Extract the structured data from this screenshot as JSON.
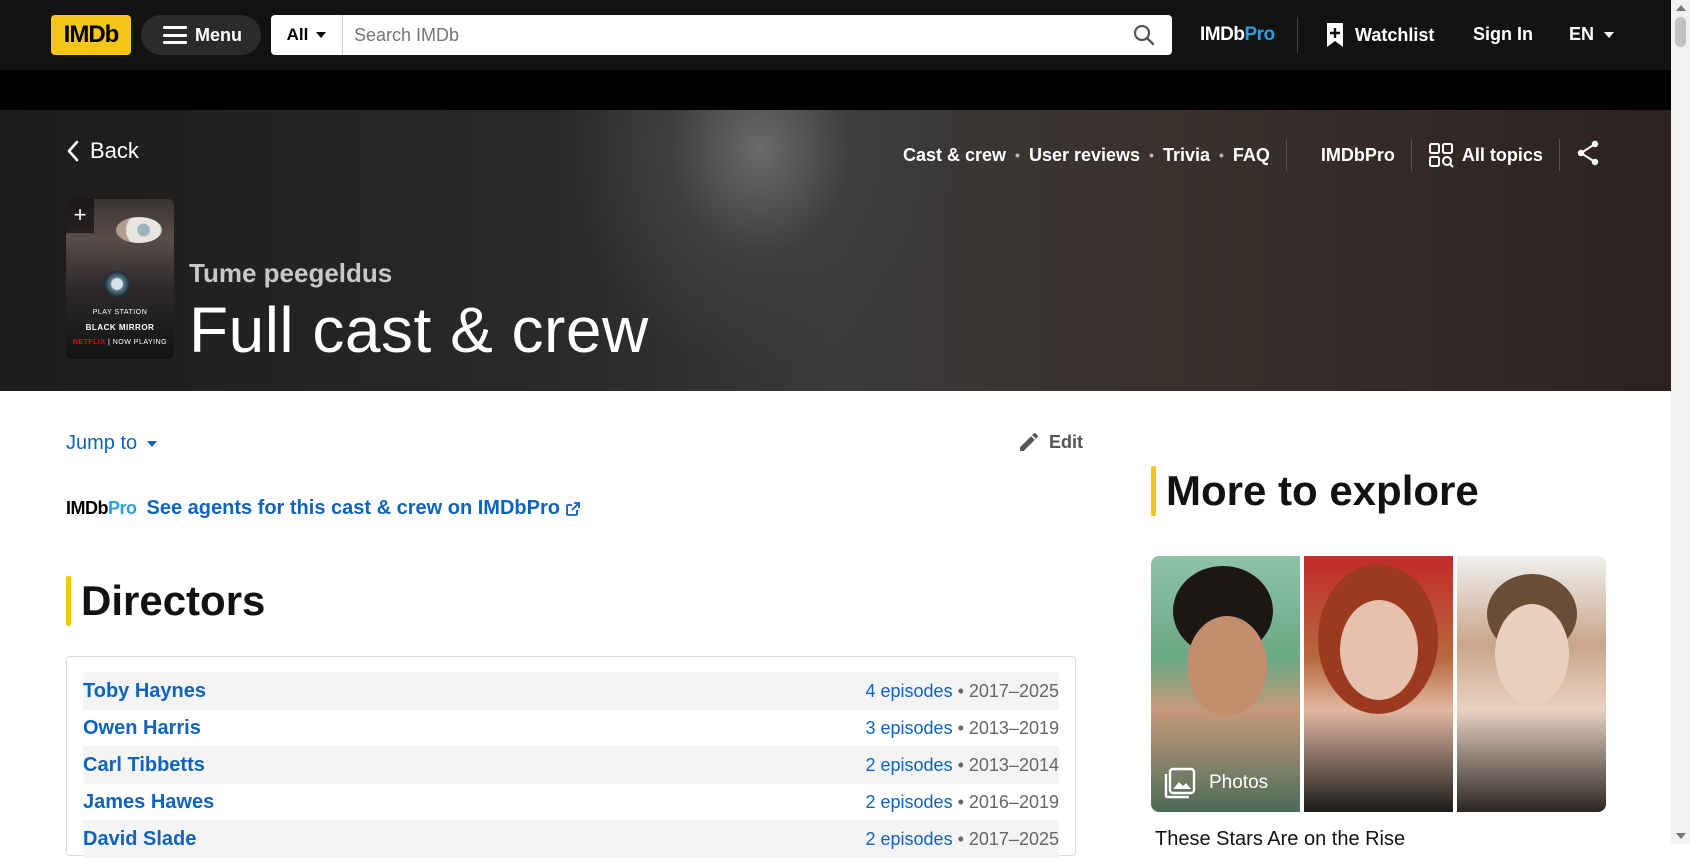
{
  "nav": {
    "logo": "IMDb",
    "menu_label": "Menu",
    "search_category": "All",
    "search_placeholder": "Search IMDb",
    "pro_logo_main": "IMDb",
    "pro_logo_pro": "Pro",
    "watchlist_label": "Watchlist",
    "signin_label": "Sign In",
    "language": "EN"
  },
  "hero": {
    "back_label": "Back",
    "subnav": {
      "cast_crew": "Cast & crew",
      "user_reviews": "User reviews",
      "trivia": "Trivia",
      "faq": "FAQ",
      "imdbpro": "IMDbPro",
      "all_topics": "All topics"
    },
    "poster": {
      "line1": "PLAY STATION",
      "line2": "BLACK MIRROR",
      "line3": "NETFLIX",
      "line4": "NOW PLAYING"
    },
    "series_title": "Tume peegeldus",
    "page_title": "Full cast & crew"
  },
  "main": {
    "jump_to": "Jump to",
    "edit": "Edit",
    "agents_pro_main": "IMDb",
    "agents_pro_pro": "Pro",
    "agents_link": "See agents for this cast & crew on IMDbPro",
    "directors_heading": "Directors",
    "directors": [
      {
        "name": "Toby Haynes",
        "episodes": "4 episodes",
        "years": "2017–2025"
      },
      {
        "name": "Owen Harris",
        "episodes": "3 episodes",
        "years": "2013–2019"
      },
      {
        "name": "Carl Tibbetts",
        "episodes": "2 episodes",
        "years": "2013–2014"
      },
      {
        "name": "James Hawes",
        "episodes": "2 episodes",
        "years": "2016–2019"
      },
      {
        "name": "David Slade",
        "episodes": "2 episodes",
        "years": "2017–2025"
      }
    ]
  },
  "rail": {
    "heading": "More to explore",
    "photos_label": "Photos",
    "rising_title": "These Stars Are on the Rise"
  },
  "colors": {
    "brand_yellow": "#f5c518",
    "link_blue": "#0e63be",
    "nav_bg": "#121212",
    "pro_blue": "#28a1e0"
  }
}
